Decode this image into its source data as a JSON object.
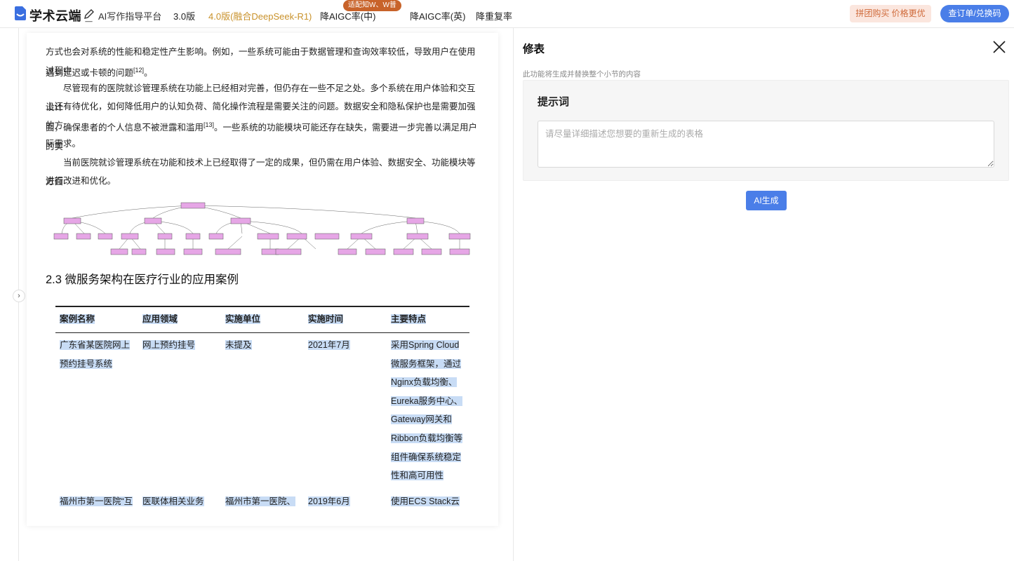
{
  "header": {
    "brand": "学术云端",
    "brand_suffix": "_",
    "subtitle": "AI写作指导平台",
    "nav": [
      "3.0版",
      "4.0版(融合DeepSeek-R1)",
      "降AIGC率(中)",
      "降AIGC率(英)",
      "降重复率"
    ],
    "badge": "适配知W、W普",
    "group_buy": "拼团购买 价格更优",
    "order": "查订单/兑换码",
    "accent": "#4a7ee8",
    "gold": "#c9922b"
  },
  "doc": {
    "paragraphs": [
      {
        "text": "方式也会对系统的性能和稳定性产生影响。例如，一些系统可能由于数据管理和查询效率较低，导致用户在使用过程中",
        "ref": ""
      },
      {
        "text": "遇到延迟或卡顿的问题",
        "ref": "[12]",
        "tail": "。"
      },
      {
        "text": "尽管现有的医院就诊管理系统在功能上已经相对完善，但仍存在一些不足之处。多个系统在用户体验和交互设计",
        "ref": ""
      },
      {
        "text": "上还有待优化，如何降低用户的认知负荷、简化操作流程是需要关注的问题。数据安全和隐私保护也是需要加强的方",
        "ref": ""
      },
      {
        "text": "面，确保患者的个人信息不被泄露和滥用",
        "ref": "[13]",
        "tail": "。一些系统的功能模块可能还存在缺失，需要进一步完善以满足用户的实"
      },
      {
        "text": "际需求。",
        "ref": ""
      },
      {
        "text": "当前医院就诊管理系统在功能和技术上已经取得了一定的成果，但仍需在用户体验、数据安全、功能模块等方面",
        "ref": ""
      },
      {
        "text": "进行改进和优化。",
        "ref": ""
      }
    ],
    "section_title": "2.3 微服务架构在医疗行业的应用案例",
    "table": {
      "headers": [
        "案例名称",
        "应用领域",
        "实施单位",
        "实施时间",
        "主要特点"
      ],
      "rows": [
        [
          "广东省某医院网上预约挂号系统",
          "网上预约挂号",
          "未提及",
          "2021年7月",
          "采用Spring Cloud微服务框架，通过Nginx负载均衡、Eureka服务中心、Gateway网关和Ribbon负载均衡等组件确保系统稳定性和高可用性"
        ],
        [
          "福州市第一医院“互",
          "医联体相关业务",
          "福州市第一医院、",
          "2019年6月",
          "使用ECS Stack云"
        ]
      ]
    }
  },
  "panel": {
    "title": "修表",
    "description": "此功能将生成并替换整个小节的内容",
    "prompt_label": "提示词",
    "prompt_placeholder": "请尽量详细描述您想要的重新生成的表格",
    "generate": "AI生成"
  }
}
